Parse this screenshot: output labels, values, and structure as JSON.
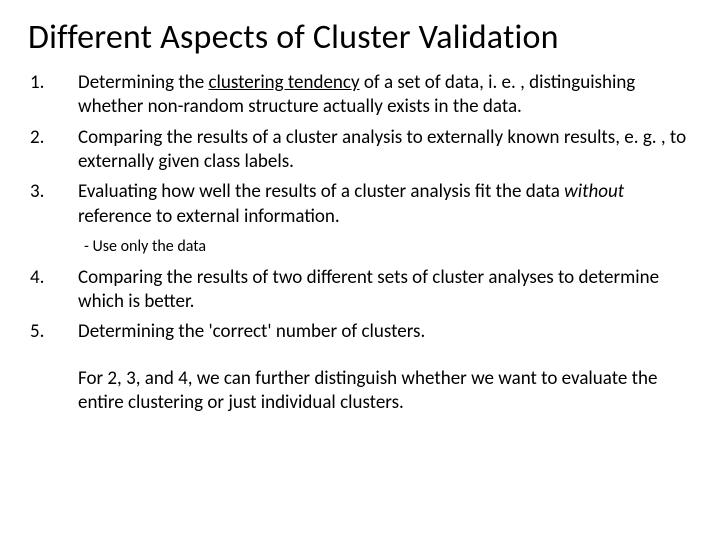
{
  "title": "Different Aspects of Cluster Validation",
  "items": [
    {
      "num": "1.",
      "pre": "Determining the ",
      "u": "clustering tendency",
      "post": " of a set of data, i. e. , distinguishing whether non-random structure actually exists in the data."
    },
    {
      "num": "2.",
      "text": "Comparing the results of a cluster analysis to externally known results, e. g. , to externally given class labels."
    },
    {
      "num": "3.",
      "pre": "Evaluating how well the results of a cluster analysis fit the data ",
      "i": "without",
      "post": " reference to external information."
    }
  ],
  "sub": "- Use only the data",
  "items2": [
    {
      "num": "4.",
      "text": "Comparing the results of two different sets of cluster analyses to determine which is better."
    },
    {
      "num": "5.",
      "text": "Determining the 'correct' number of clusters."
    }
  ],
  "footer": "For 2, 3, and 4, we can further distinguish whether we want to evaluate the entire clustering or just individual clusters."
}
